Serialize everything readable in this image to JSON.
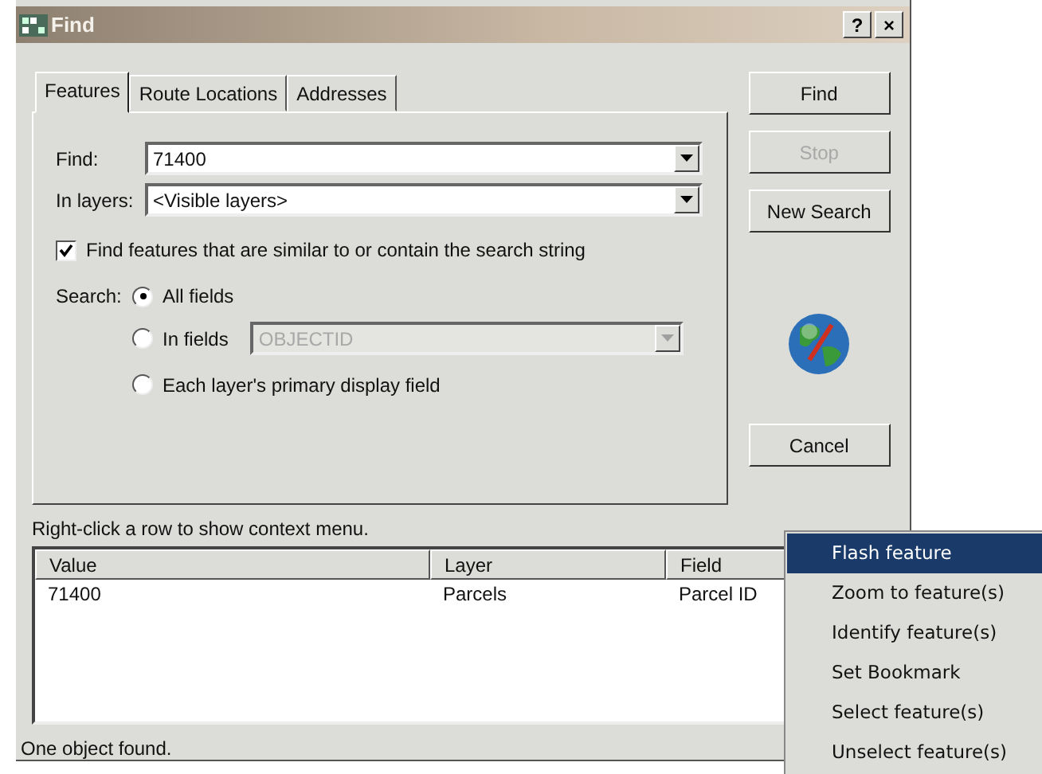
{
  "window": {
    "title": "Find",
    "title_buttons": [
      "?",
      "×"
    ]
  },
  "tabs": [
    {
      "label": "Features",
      "selected": true
    },
    {
      "label": "Route Locations",
      "selected": false
    },
    {
      "label": "Addresses",
      "selected": false
    }
  ],
  "find_field": {
    "label": "Find:",
    "value": "71400"
  },
  "layers_field": {
    "label": "In layers:",
    "value": "<Visible layers>"
  },
  "similar_checkbox": {
    "label": "Find features that are similar to or contain the search string",
    "checked": true
  },
  "search": {
    "label": "Search:",
    "options": [
      {
        "label": "All fields",
        "selected": true
      },
      {
        "label": "In fields",
        "selected": false,
        "field": {
          "value": "OBJECTID",
          "disabled": true
        }
      },
      {
        "label": "Each layer's primary display field",
        "selected": false
      }
    ]
  },
  "buttons": [
    {
      "label": "Find",
      "disabled": false
    },
    {
      "label": "Stop",
      "disabled": true
    },
    {
      "label": "New Search",
      "disabled": false
    }
  ],
  "cancel_button": {
    "label": "Cancel",
    "disabled": false
  },
  "hint": "Right-click a row to show context menu.",
  "results": {
    "columns": [
      "Value",
      "Layer",
      "Field"
    ],
    "rows": [
      {
        "cells": [
          "71400",
          "Parcels",
          "Parcel ID"
        ],
        "selected": false
      }
    ]
  },
  "status_bar": "One object found.",
  "context_menu": [
    {
      "label": "Flash feature",
      "selected": true
    },
    {
      "label": "Zoom to feature(s)",
      "selected": false
    },
    {
      "label": "Identify feature(s)",
      "selected": false
    },
    {
      "label": "Set Bookmark",
      "selected": false
    },
    {
      "label": "Select feature(s)",
      "selected": false
    },
    {
      "label": "Unselect feature(s)",
      "selected": false
    }
  ]
}
